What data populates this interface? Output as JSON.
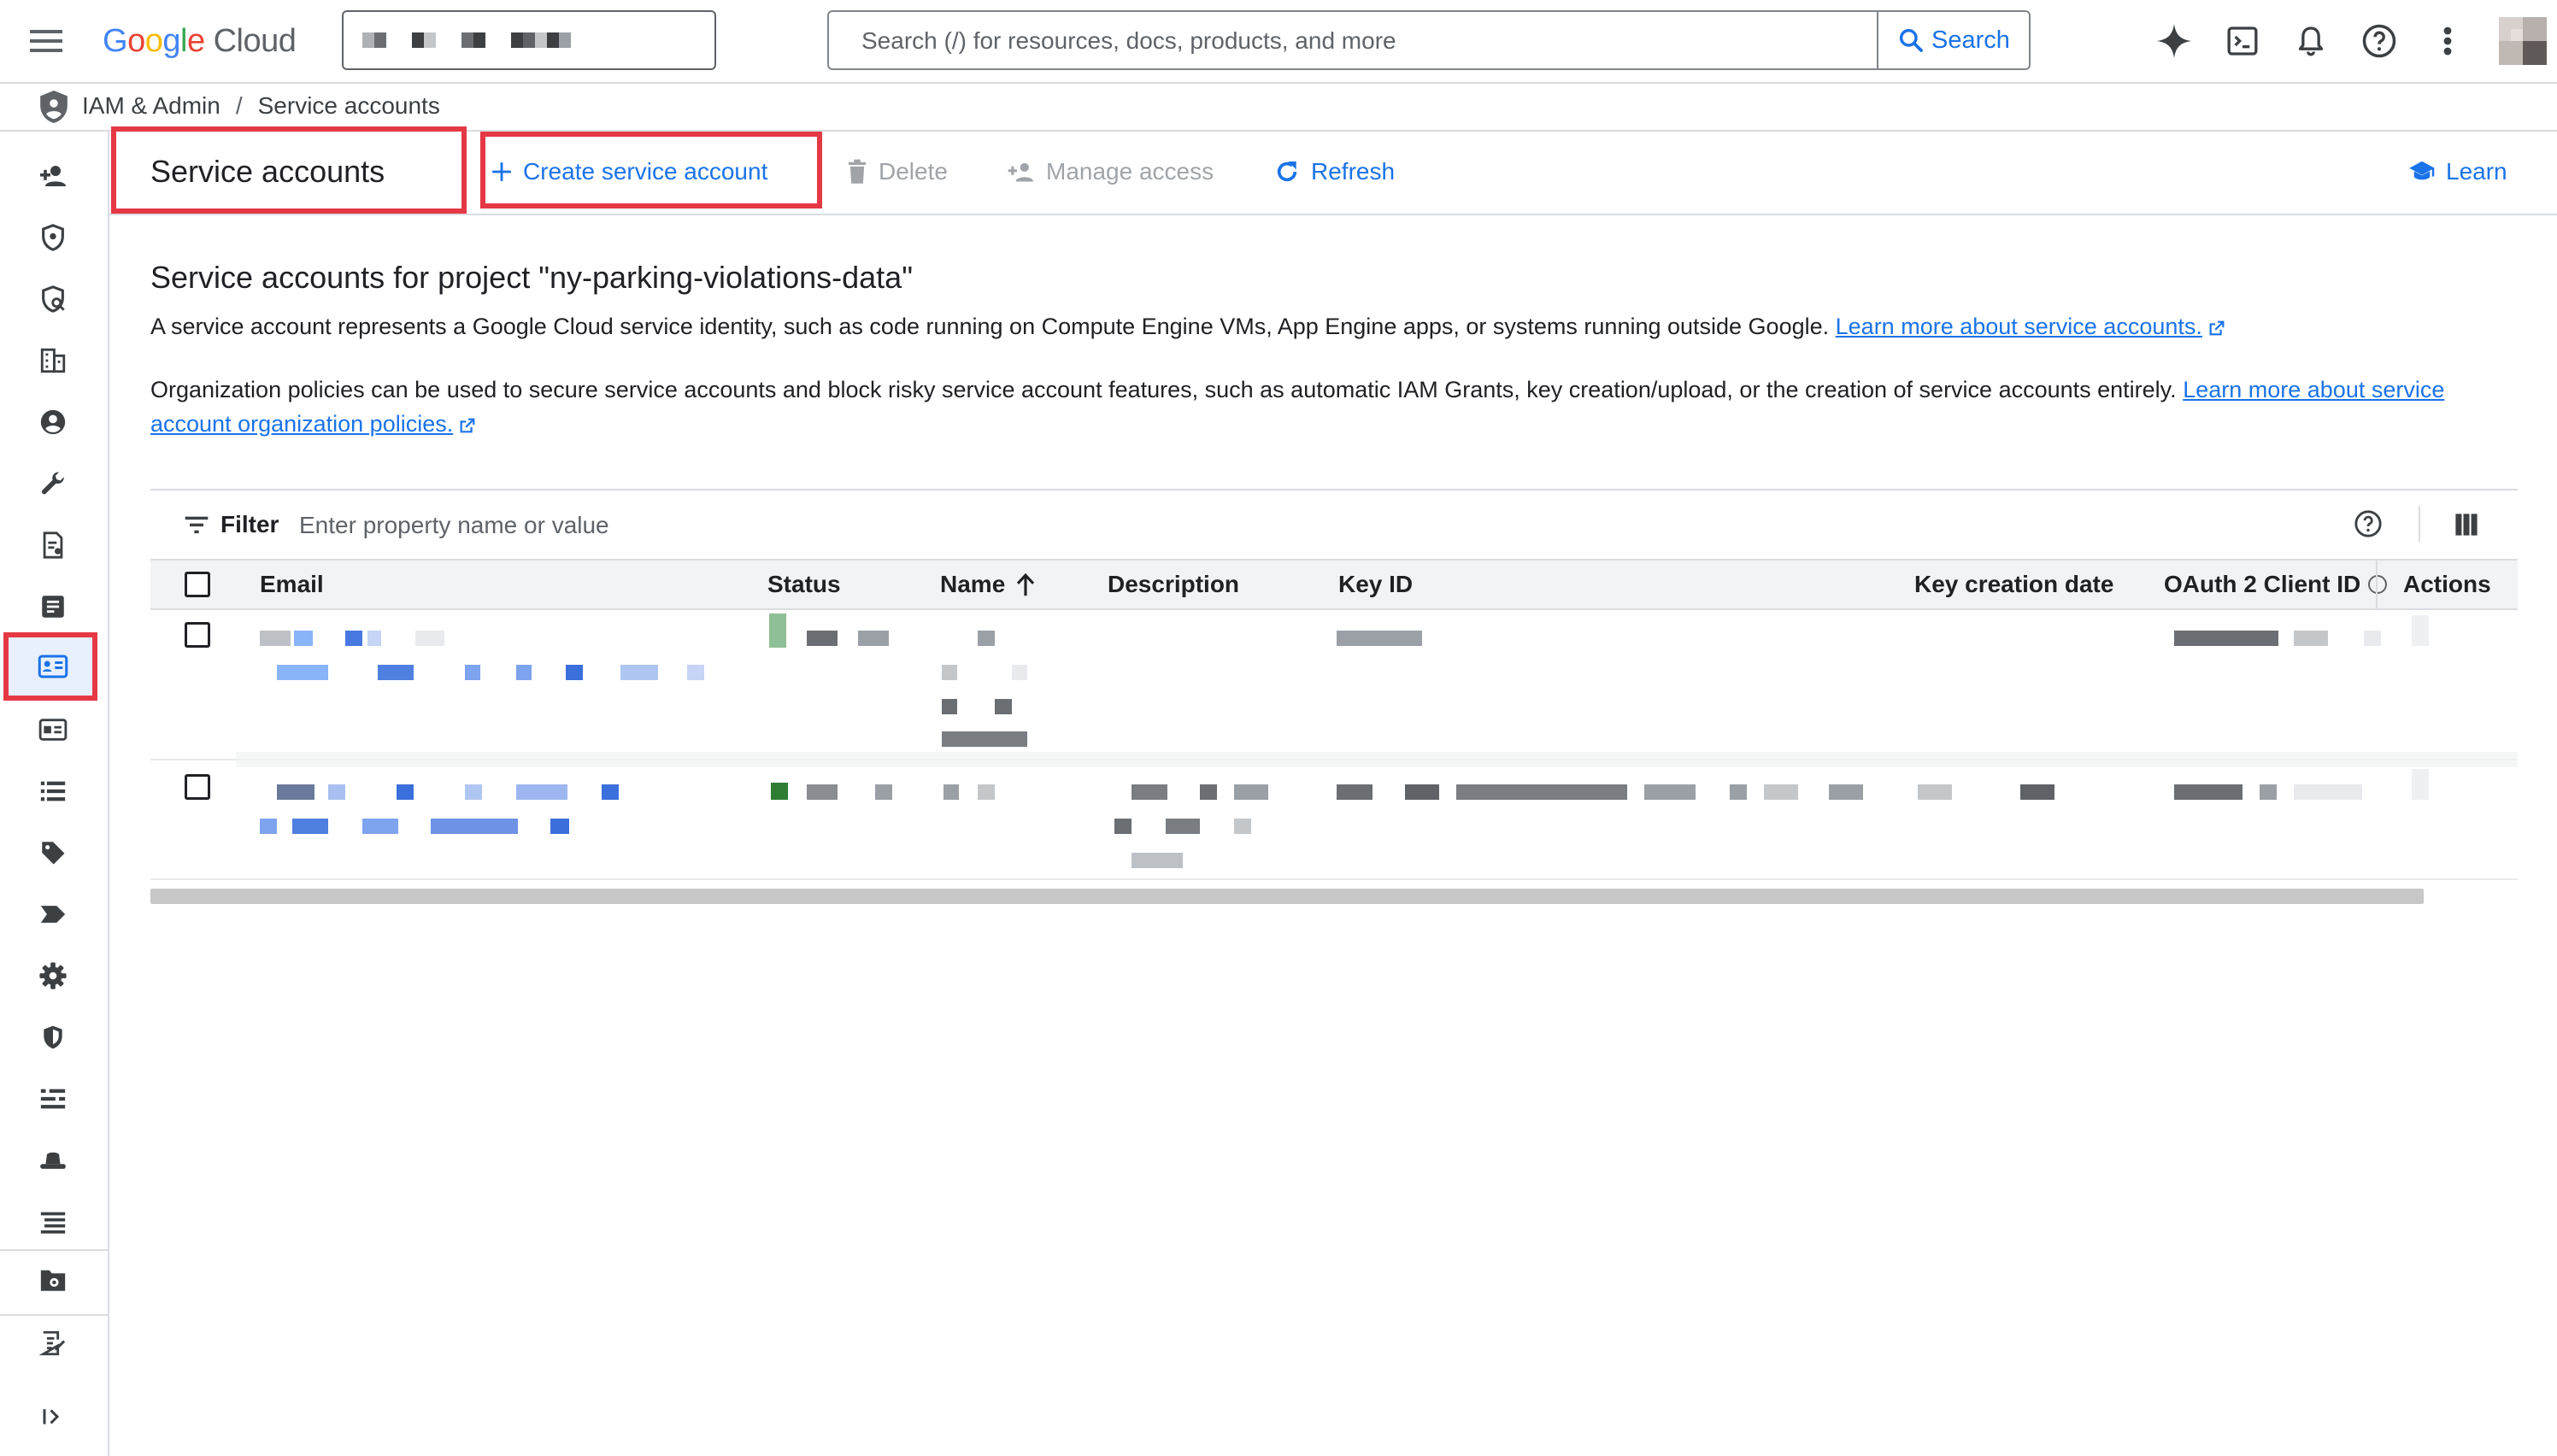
{
  "app": {
    "logo_google": "Google",
    "logo_cloud": "Cloud",
    "search_placeholder": "Search (/) for resources, docs, products, and more",
    "search_button": "Search"
  },
  "breadcrumb": {
    "parent": "IAM & Admin",
    "separator": "/",
    "current": "Service accounts"
  },
  "toolbar": {
    "title": "Service accounts",
    "create": "Create service account",
    "delete": "Delete",
    "manage_access": "Manage access",
    "refresh": "Refresh",
    "learn": "Learn"
  },
  "content": {
    "heading": "Service accounts for project \"ny-parking-violations-data\"",
    "intro": "A service account represents a Google Cloud service identity, such as code running on Compute Engine VMs, App Engine apps, or systems running outside Google.",
    "intro_link": "Learn more about service accounts.",
    "policy_text": "Organization policies can be used to secure service accounts and block risky service account features, such as automatic IAM Grants, key creation/upload, or the creation of service accounts entirely.",
    "policy_link": "Learn more about service account organization policies."
  },
  "table": {
    "filter_label": "Filter",
    "filter_placeholder": "Enter property name or value",
    "columns": {
      "email": "Email",
      "status": "Status",
      "name": "Name",
      "description": "Description",
      "key_id": "Key ID",
      "key_creation_date": "Key creation date",
      "oauth_client_id": "OAuth 2 Client ID",
      "actions": "Actions"
    },
    "sort_column": "Name",
    "sort_direction": "ascending"
  },
  "colors": {
    "accent": "#1a73e8",
    "highlight": "#e53845",
    "status_enabled": "#2e7d32"
  },
  "icons": {
    "rail": [
      "person-add-icon",
      "shield-icon",
      "policy-icon",
      "org-icon",
      "account-icon",
      "wrench-icon",
      "audit-icon",
      "report-icon",
      "service-account-icon",
      "id-card-icon",
      "list-icon",
      "tag-icon",
      "label-icon",
      "settings-icon",
      "privacy-icon",
      "quota-icon",
      "hat-icon",
      "manage-list-icon",
      "folder-settings-icon",
      "release-notes-icon",
      "expand-icon"
    ]
  }
}
